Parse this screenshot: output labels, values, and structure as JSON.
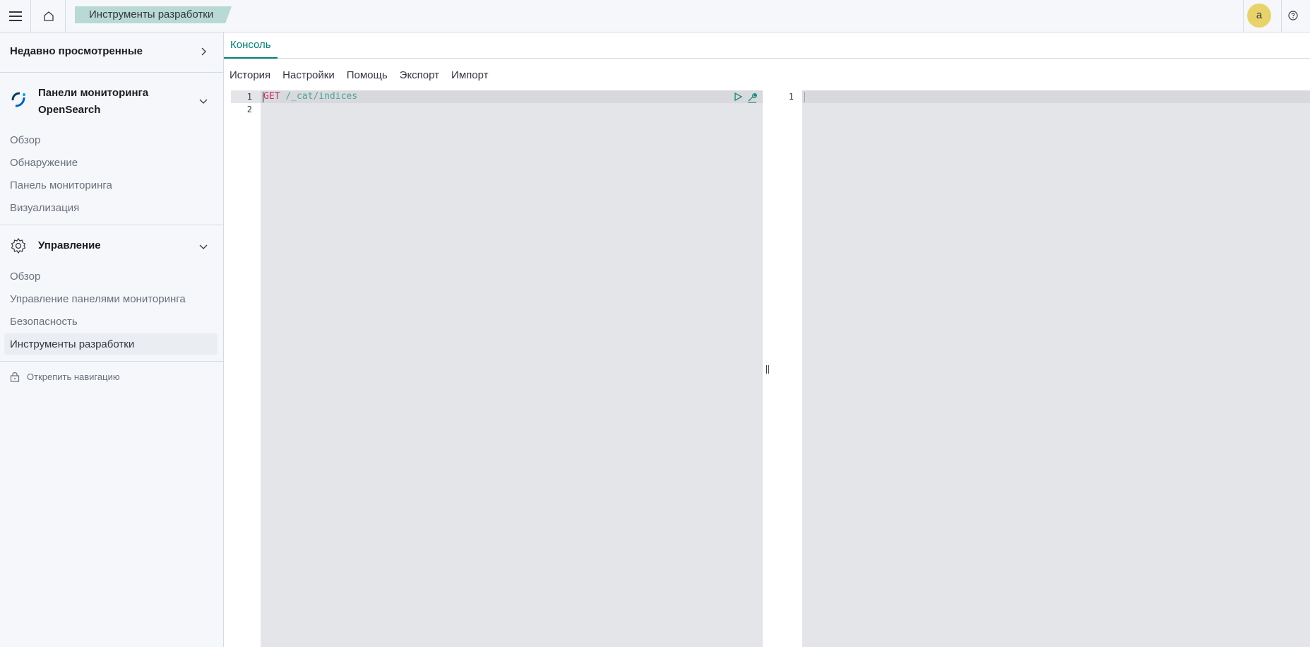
{
  "header": {
    "breadcrumb": "Инструменты разработки",
    "avatar_letter": "a"
  },
  "sidebar": {
    "recent_title": "Недавно просмотренные",
    "opensearch_group": {
      "title_line1": "Панели мониторинга",
      "title_line2": "OpenSearch",
      "items": [
        "Обзор",
        "Обнаружение",
        "Панель мониторинга",
        "Визуализация"
      ]
    },
    "management_group": {
      "title": "Управление",
      "items": [
        "Обзор",
        "Управление панелями мониторинга",
        "Безопасность",
        "Инструменты разработки"
      ]
    },
    "unpin_label": "Открепить навигацию"
  },
  "main": {
    "tab_label": "Консоль",
    "toolbar": [
      "История",
      "Настройки",
      "Помощь",
      "Экспорт",
      "Импорт"
    ],
    "editor": {
      "line_numbers": [
        "1",
        "2"
      ],
      "method": "GET",
      "path": "/_cat/indices"
    },
    "output": {
      "line_numbers": [
        "1"
      ]
    }
  },
  "colors": {
    "accent": "#017d73",
    "breadcrumb_bg": "#b9d9d5",
    "avatar_bg": "#e7d36a",
    "method": "#c8336d"
  }
}
